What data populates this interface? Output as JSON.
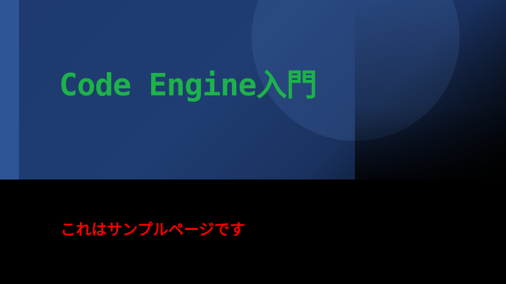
{
  "slide": {
    "title": "Code Engine入門",
    "body_text": "これはサンプルページです"
  },
  "colors": {
    "title_color": "#1db34a",
    "body_text_color": "#ff0000",
    "band_color": "#1e3a6e",
    "accent_strip_color": "#2e5596",
    "background": "#000000"
  }
}
